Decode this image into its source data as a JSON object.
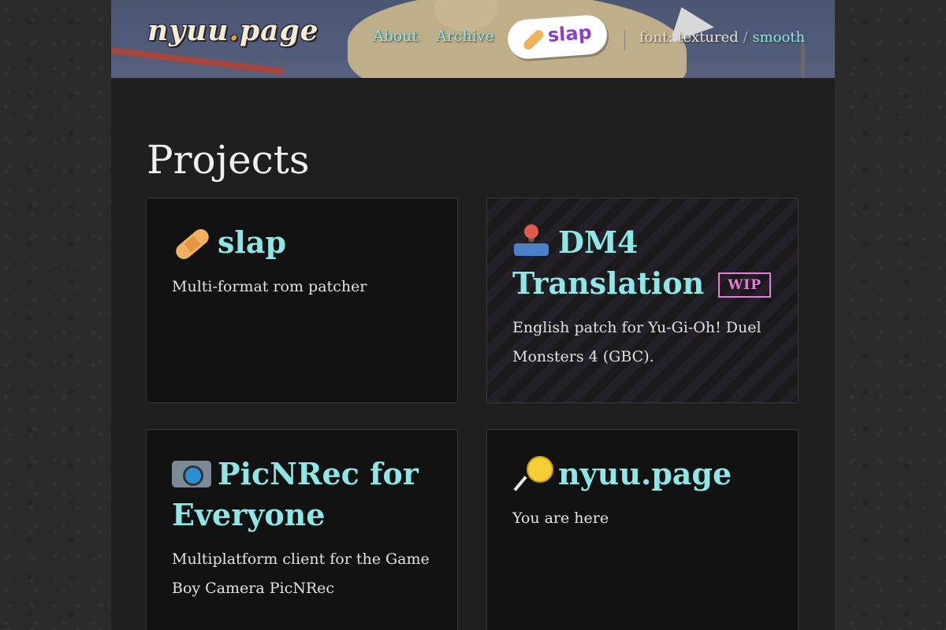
{
  "header": {
    "logo": {
      "name": "nyuu",
      "dot": ".",
      "tld": "page"
    },
    "nav": {
      "about": "About",
      "archive": "Archive"
    },
    "featured": {
      "label": "slap",
      "icon": "bandage-icon"
    },
    "font_switch": {
      "label": "font:",
      "option_textured": "textured",
      "separator": "/",
      "option_smooth": "smooth"
    }
  },
  "main": {
    "title": "Projects",
    "projects": [
      {
        "icon": "bandage-icon",
        "title": "slap",
        "description": "Multi-format rom patcher",
        "badge": ""
      },
      {
        "icon": "joystick-icon",
        "title": "DM4 Translation",
        "description": "English patch for Yu-Gi-Oh! Duel Monsters 4 (GBC).",
        "badge": "WIP"
      },
      {
        "icon": "camera-icon",
        "title": "PicNRec for Everyone",
        "description": "Multiplatform client for the Game Boy Camera PicNRec",
        "badge": ""
      },
      {
        "icon": "lollipop-icon",
        "title": "nyuu.page",
        "description": "You are here",
        "badge": ""
      }
    ]
  },
  "colors": {
    "accent": "#8ee6e6",
    "wip": "#e67fd8",
    "background": "#1f1f1f",
    "card": "#121212"
  }
}
